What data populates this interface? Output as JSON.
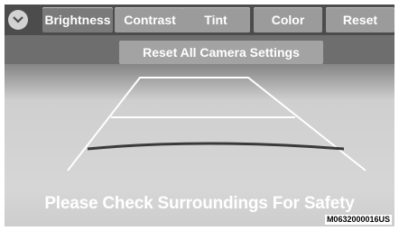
{
  "tabs": [
    {
      "label": "Brightness"
    },
    {
      "label": "Contrast"
    },
    {
      "label": "Tint"
    },
    {
      "label": "Color"
    },
    {
      "label": "Reset"
    }
  ],
  "reset_all_label": "Reset All Camera Settings",
  "safety_message": "Please Check Surroundings For Safety",
  "image_code": "M0632000016US",
  "icons": {
    "collapse": "chevron-down-icon"
  },
  "colors": {
    "tab": "#9b9b9b",
    "active_tab": "#7a7a7a",
    "bar": "#4c4c4c"
  }
}
